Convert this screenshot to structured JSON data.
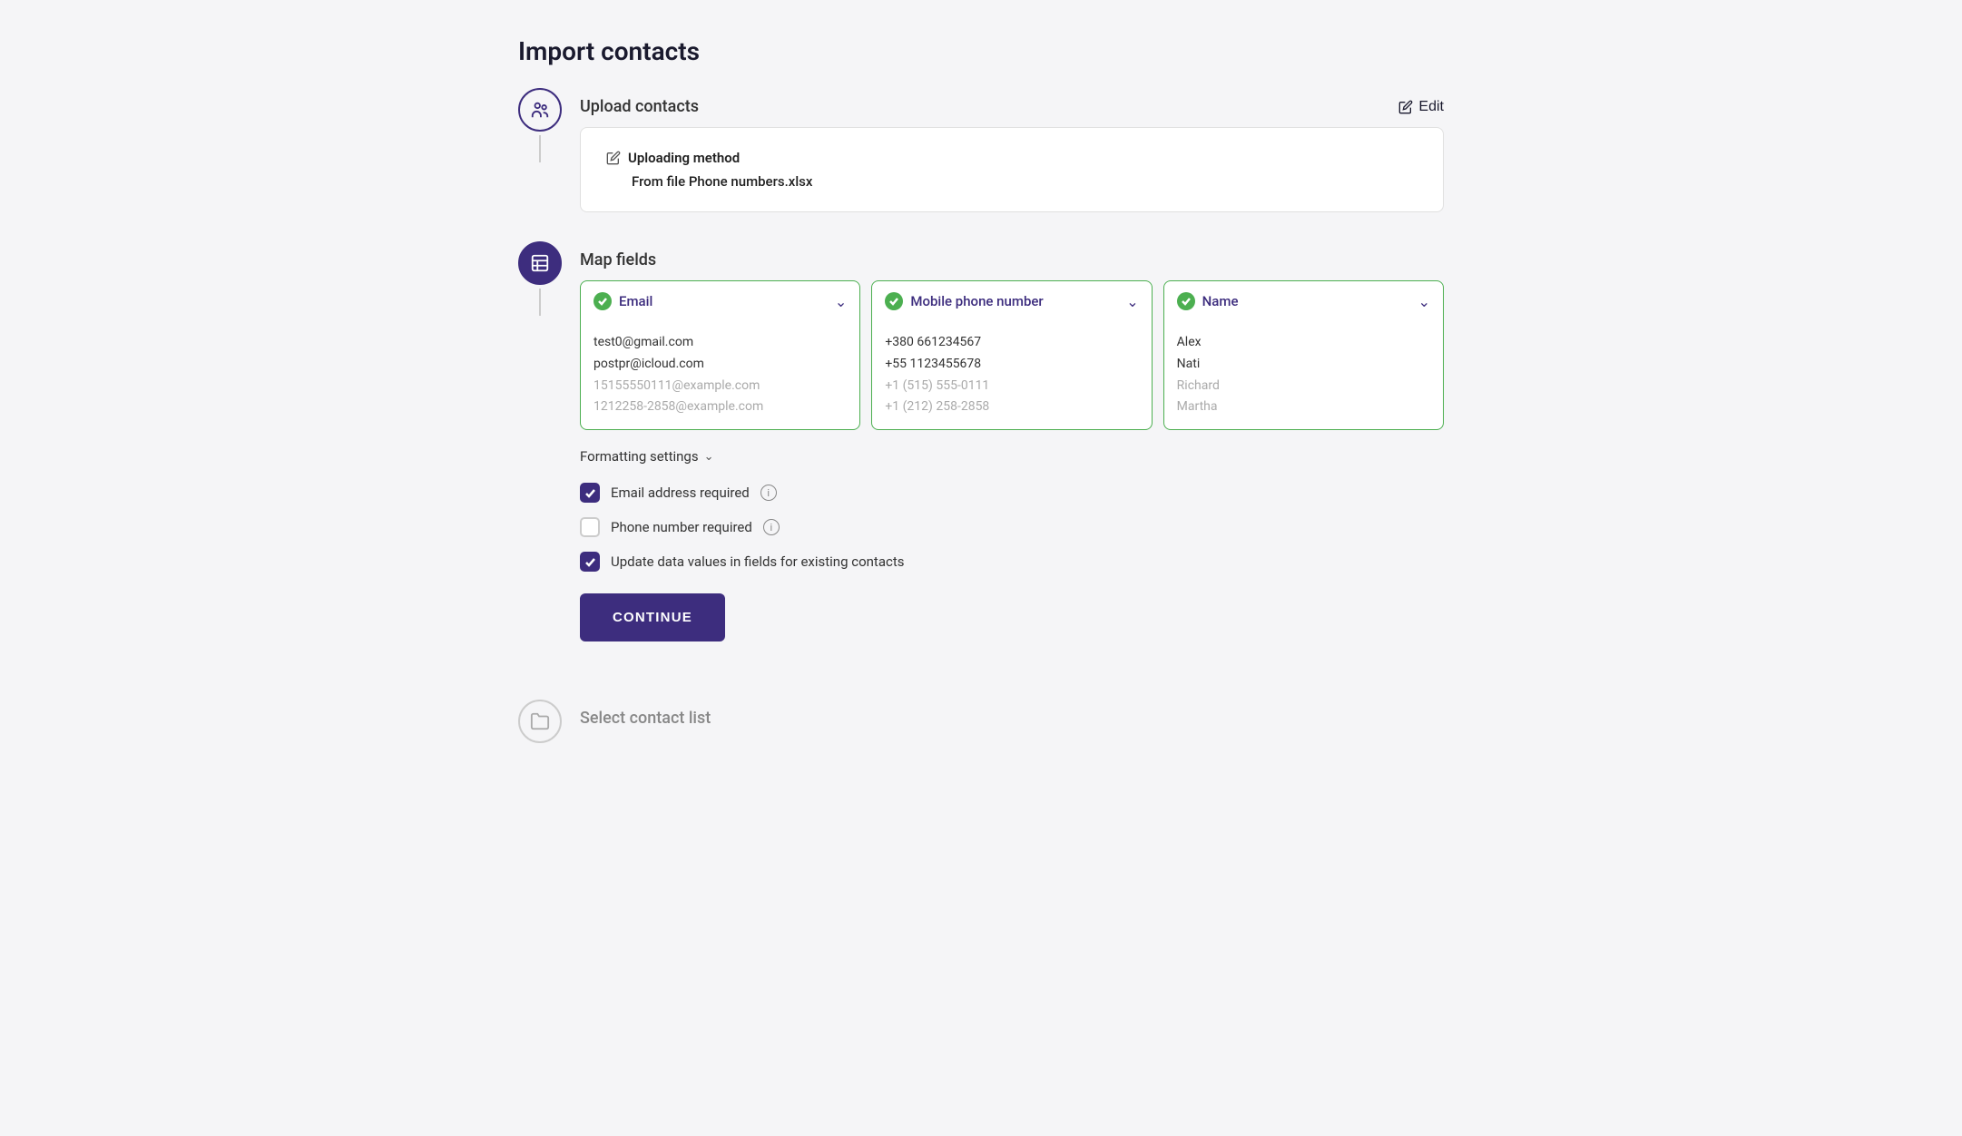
{
  "page": {
    "title": "Import contacts"
  },
  "step1": {
    "label": "Upload contacts",
    "edit_label": "Edit",
    "card": {
      "method_label": "Uploading method",
      "method_value": "From file Phone numbers.xlsx"
    }
  },
  "step2": {
    "label": "Map fields",
    "columns": [
      {
        "field_name": "Email",
        "data": [
          "test0@gmail.com",
          "postpr@icloud.com",
          "15155550111@example.com",
          "1212258-2858@example.com"
        ]
      },
      {
        "field_name": "Mobile phone number",
        "data": [
          "+380 661234567",
          "+55 1123455678",
          "+1 (515) 555-0111",
          "+1 (212) 258-2858"
        ]
      },
      {
        "field_name": "Name",
        "data": [
          "Alex",
          "Nati",
          "Richard",
          "Martha"
        ]
      }
    ],
    "formatting_settings_label": "Formatting settings",
    "checkboxes": [
      {
        "label": "Email address required",
        "checked": true,
        "has_info": true
      },
      {
        "label": "Phone number required",
        "checked": false,
        "has_info": true
      },
      {
        "label": "Update data values in fields for existing contacts",
        "checked": true,
        "has_info": false
      }
    ],
    "continue_label": "CONTINUE"
  },
  "step3": {
    "label": "Select contact list"
  },
  "icons": {
    "users": "👥",
    "table": "⊞",
    "folder": "🗂"
  }
}
